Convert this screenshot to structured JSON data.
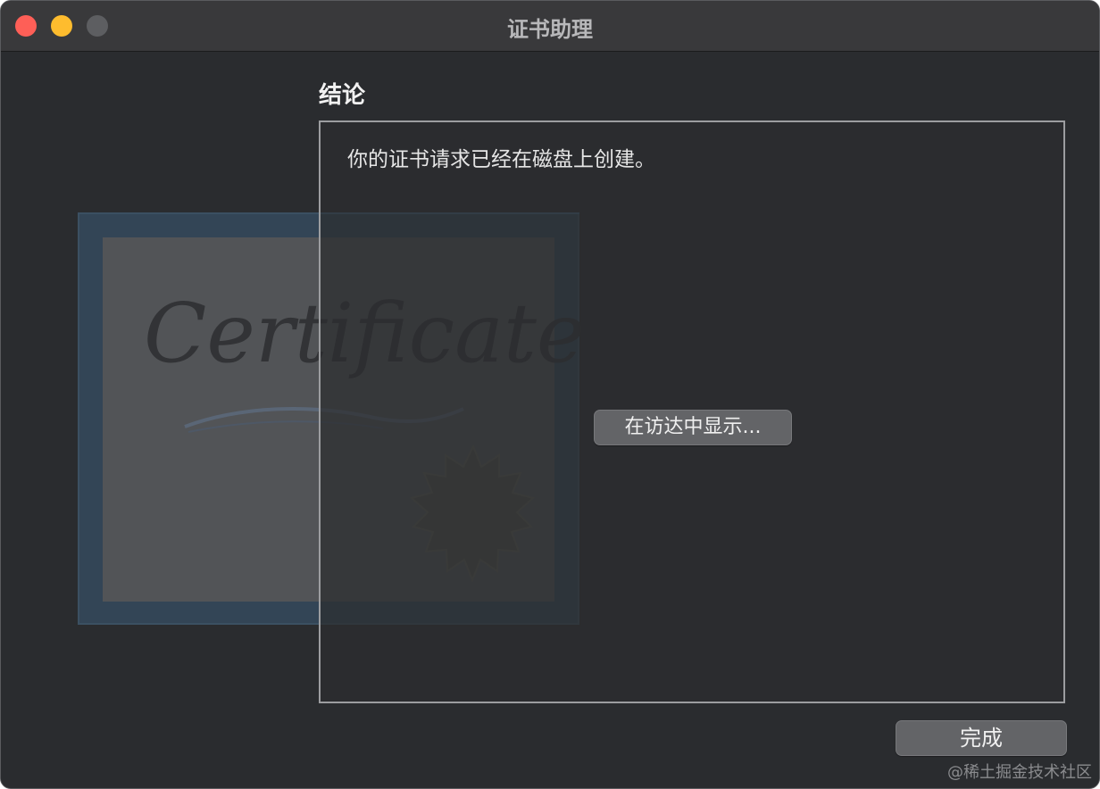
{
  "window": {
    "title": "证书助理",
    "controls": [
      "close",
      "minimize",
      "zoom"
    ]
  },
  "illustration": {
    "script_text": "Certificate",
    "icon": "certificate-icon"
  },
  "section": {
    "heading": "结论"
  },
  "panel": {
    "message": "你的证书请求已经在磁盘上创建。",
    "show_in_finder_label": "在访达中显示..."
  },
  "footer": {
    "done_label": "完成"
  },
  "watermark": "@稀土掘金技术社区",
  "colors": {
    "close": "#fe5f57",
    "minimize": "#febc2e",
    "zoom_inactive": "#5d5e61",
    "window_bg": "#2a2c2f",
    "button_bg": "#636467"
  }
}
